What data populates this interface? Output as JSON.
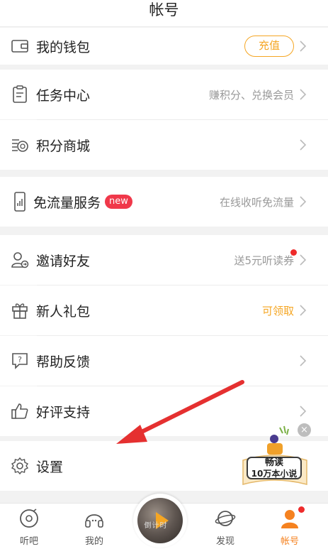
{
  "header": {
    "title": "帐号"
  },
  "rows": {
    "wallet": {
      "label": "我的钱包",
      "button": "充值"
    },
    "tasks": {
      "label": "任务中心",
      "hint": "赚积分、兑换会员"
    },
    "points_mall": {
      "label": "积分商城"
    },
    "free_data": {
      "label": "免流量服务",
      "badge": "new",
      "hint": "在线收听免流量"
    },
    "invite": {
      "label": "邀请好友",
      "hint": "送5元听读券"
    },
    "gift": {
      "label": "新人礼包",
      "hint": "可领取"
    },
    "feedback": {
      "label": "帮助反馈"
    },
    "rating": {
      "label": "好评支持"
    },
    "settings": {
      "label": "设置"
    }
  },
  "promo": {
    "line1": "畅读",
    "line2": "10万本小说"
  },
  "colors": {
    "accent": "#f5a623",
    "badge_red": "#f0384a",
    "arrow": "#e53030",
    "active_tab": "#f58220"
  },
  "tabs": [
    {
      "label": "听吧",
      "icon": "vinyl-icon"
    },
    {
      "label": "我的",
      "icon": "headphones-icon"
    },
    {
      "label": "发现",
      "icon": "planet-icon"
    },
    {
      "label": "帐号",
      "icon": "person-icon",
      "active": true
    }
  ],
  "player": {
    "text": "倒计时"
  }
}
